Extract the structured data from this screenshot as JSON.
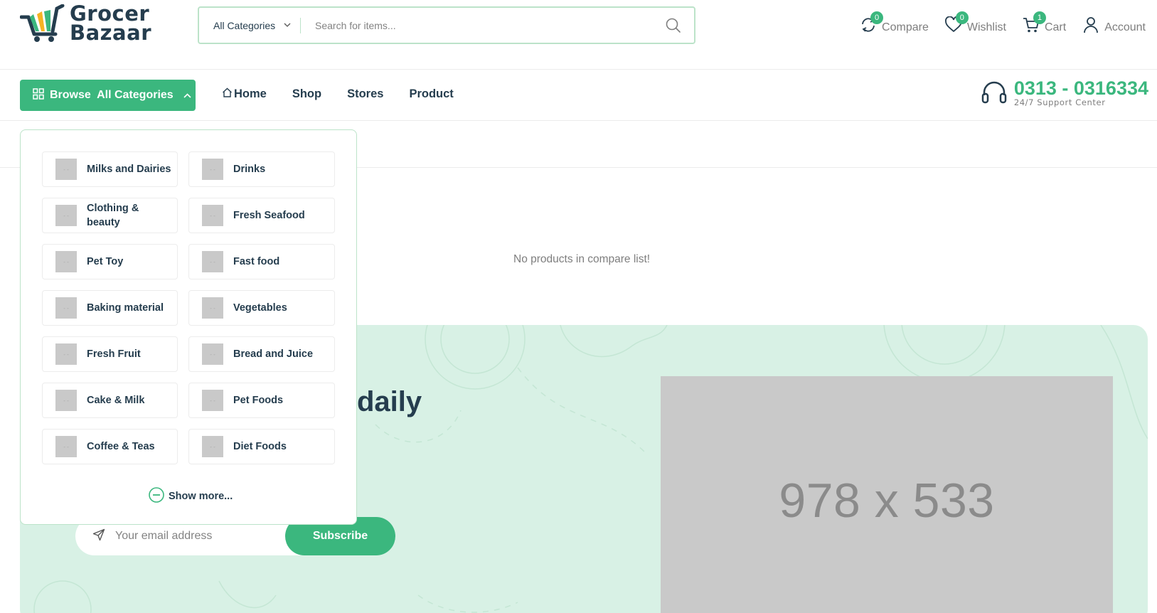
{
  "brand": {
    "line1": "Grocer",
    "line2": "Bazaar",
    "accent": "#3bb77e",
    "dark": "#253d4e"
  },
  "search": {
    "category": "All Categories",
    "placeholder": "Search for items..."
  },
  "header_actions": [
    {
      "label": "Compare",
      "count": "0",
      "icon": "compare-icon"
    },
    {
      "label": "Wishlist",
      "count": "0",
      "icon": "heart-icon"
    },
    {
      "label": "Cart",
      "count": "1",
      "icon": "cart-icon"
    },
    {
      "label": "Account",
      "icon": "user-icon"
    }
  ],
  "nav": {
    "browse_label": "Browse  All Categories",
    "links": [
      "Home",
      "Shop",
      "Stores",
      "Product"
    ]
  },
  "support": {
    "phone": "0313 - 0316334",
    "subtitle": "24/7 Support Center"
  },
  "compare": {
    "empty_message": "No products in compare list!"
  },
  "categories": [
    "Milks and Dairies",
    "Drinks",
    "Clothing & beauty",
    "Fresh Seafood",
    "Pet Toy",
    "Fast food",
    "Baking material",
    "Vegetables",
    "Fresh Fruit",
    "Bread and Juice",
    "Cake & Milk",
    "Pet Foods",
    "Coffee & Teas",
    "Diet Foods"
  ],
  "show_more": "Show more...",
  "newsletter": {
    "title_fragment": "daily",
    "email_placeholder": "Your email address",
    "button": "Subscribe",
    "image_placeholder": "978 x 533"
  }
}
